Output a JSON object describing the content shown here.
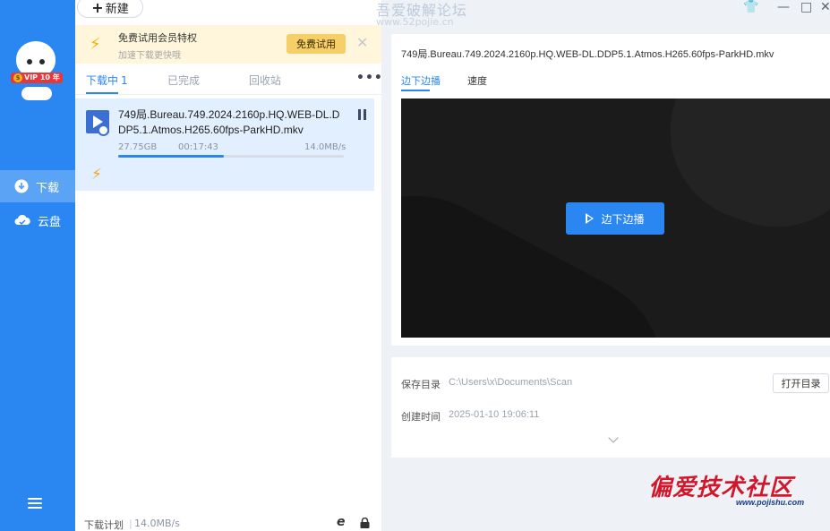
{
  "colors": {
    "brand": "#2a86f0",
    "promo_bg": "#fff6dc",
    "trial_btn": "#f6cf68",
    "selected_row": "#e1efff",
    "logo_red": "#d4162c"
  },
  "sidebar": {
    "vip_badge": "VIP 10",
    "vip_year": "年",
    "items": [
      {
        "label": "下载",
        "icon": "download-icon",
        "active": true
      },
      {
        "label": "云盘",
        "icon": "cloud-icon",
        "active": false
      }
    ],
    "menu_icon": "hamburger-menu-icon"
  },
  "toolbar": {
    "new_label": "新建"
  },
  "watermark": {
    "text": "吾爱破解论坛",
    "url": "www.52pojie.cn"
  },
  "promo": {
    "title": "免费试用会员特权",
    "subtitle": "加速下载更快哦",
    "trial_button": "免费试用"
  },
  "tabs": [
    {
      "label": "下载中",
      "count": "1"
    },
    {
      "label": "已完成"
    },
    {
      "label": "回收站"
    }
  ],
  "task": {
    "filename": "749局.Bureau.749.2024.2160p.HQ.WEB-DL.DDP5.1.Atmos.H265.60fps-ParkHD.mkv",
    "size": "27.75GB",
    "time_remaining": "00:17:43",
    "speed": "14.0MB/s",
    "progress": 0.47
  },
  "footer": {
    "plan": "下载计划",
    "speed": "14.0MB/s"
  },
  "detail": {
    "title": "749局.Bureau.749.2024.2160p.HQ.WEB-DL.DDP5.1.Atmos.H265.60fps-ParkHD.mkv",
    "tabs": [
      "边下边播",
      "速度"
    ],
    "play_button": "边下边播"
  },
  "info": {
    "save_dir_label": "保存目录",
    "save_dir": "C:\\Users\\x\\Documents\\Scan",
    "open_button": "打开目录",
    "created_label": "创建时间",
    "created": "2025-01-10 19:06:11"
  },
  "logo": {
    "text": "偏爱技术社区",
    "url": "www.pojishu.com"
  }
}
